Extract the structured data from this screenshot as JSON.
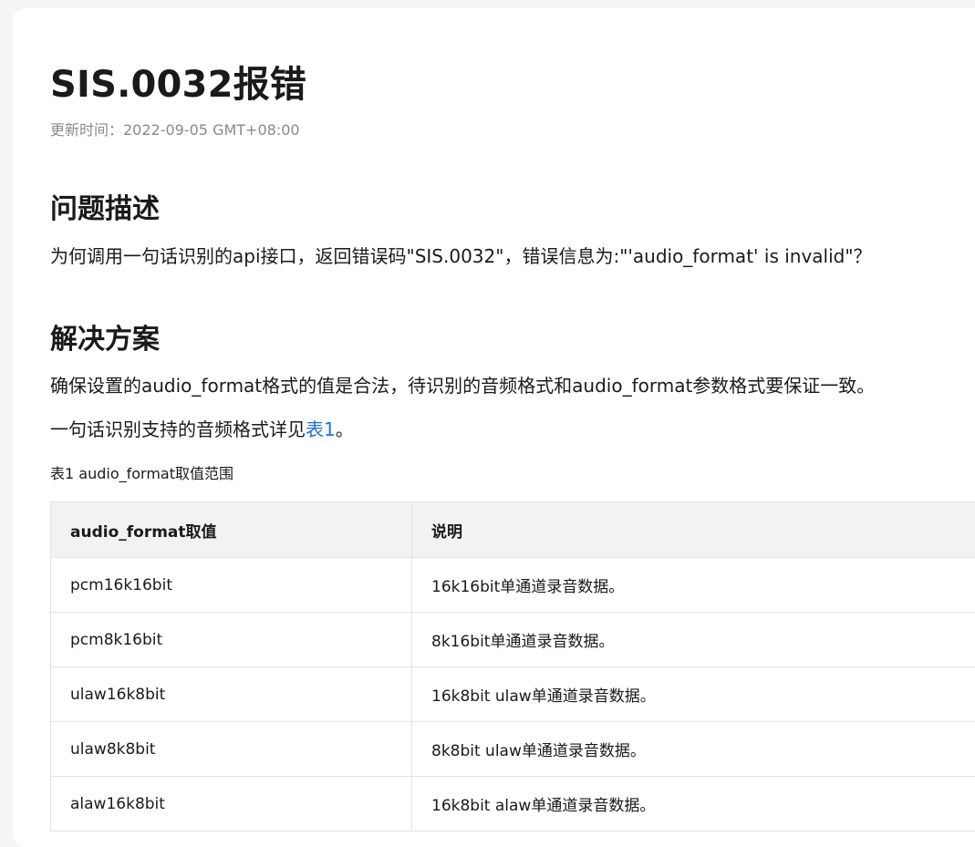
{
  "doc": {
    "title": "SIS.0032报错",
    "updated": "更新时间：2022-09-05 GMT+08:00"
  },
  "problem": {
    "heading": "问题描述",
    "text": "为何调用一句话识别的api接口，返回错误码\"SIS.0032\"，错误信息为:\"'audio_format' is invalid\"？"
  },
  "solution": {
    "heading": "解决方案",
    "text1": "确保设置的audio_format格式的值是合法，待识别的音频格式和audio_format参数格式要保证一致。",
    "text2_prefix": "一句话识别支持的音频格式详见",
    "text2_link": "表1",
    "text2_suffix": "。"
  },
  "table": {
    "caption": "表1 audio_format取值范围",
    "headers": [
      "audio_format取值",
      "说明"
    ],
    "rows": [
      [
        "pcm16k16bit",
        "16k16bit单通道录音数据。"
      ],
      [
        "pcm8k16bit",
        "8k16bit单通道录音数据。"
      ],
      [
        "ulaw16k8bit",
        "16k8bit ulaw单通道录音数据。"
      ],
      [
        "ulaw8k8bit",
        "8k8bit ulaw单通道录音数据。"
      ],
      [
        "alaw16k8bit",
        "16k8bit alaw单通道录音数据。"
      ]
    ]
  },
  "colors": {
    "link": "#1e6fe0",
    "header_bg": "#f2f2f2",
    "muted": "#8a8a8a"
  }
}
